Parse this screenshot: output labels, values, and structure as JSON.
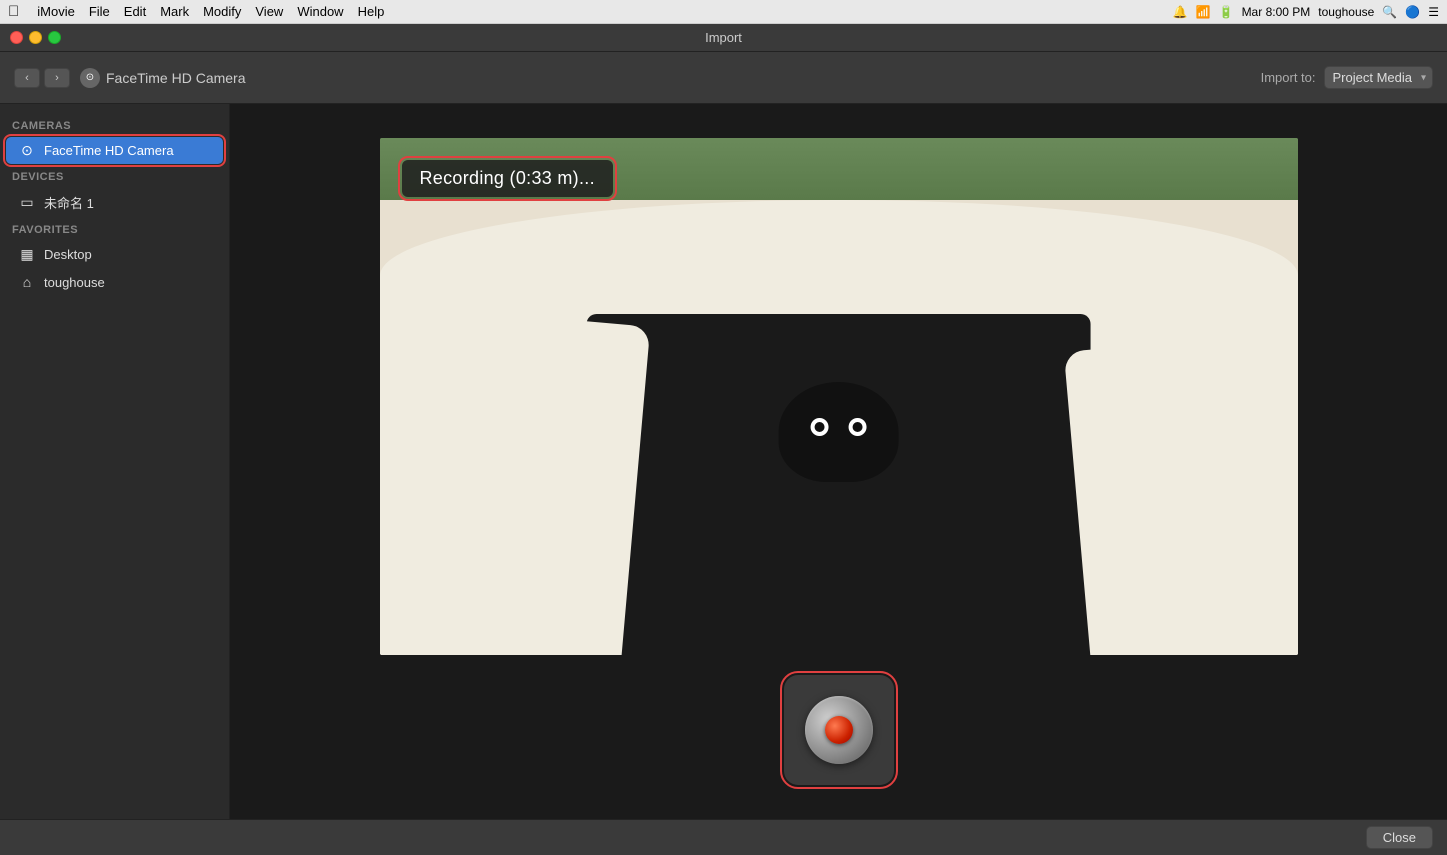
{
  "menubar": {
    "apple": "&#63743;",
    "items": [
      "iMovie",
      "File",
      "Edit",
      "Mark",
      "Modify",
      "View",
      "Window",
      "Help"
    ],
    "right": {
      "time": "Mar 8:00 PM",
      "user": "toughouse"
    }
  },
  "titlebar": {
    "title": "Import"
  },
  "toolbar": {
    "nav_back": "‹",
    "nav_forward": "›",
    "camera_icon": "⊙",
    "camera_name": "FaceTime HD Camera",
    "import_to_label": "Import to:",
    "import_dropdown": "Project Media"
  },
  "sidebar": {
    "cameras_label": "CAMERAS",
    "cameras": [
      {
        "icon": "⊙",
        "label": "FaceTime HD Camera",
        "active": true
      }
    ],
    "devices_label": "DEVICES",
    "devices": [
      {
        "icon": "▭",
        "label": "未命名 1"
      }
    ],
    "favorites_label": "FAVORITES",
    "favorites": [
      {
        "icon": "▦",
        "label": "Desktop"
      },
      {
        "icon": "⌂",
        "label": "toughouse"
      }
    ]
  },
  "recording": {
    "status_text": "Recording (0:33 m)..."
  },
  "bottom_bar": {
    "close_label": "Close"
  }
}
